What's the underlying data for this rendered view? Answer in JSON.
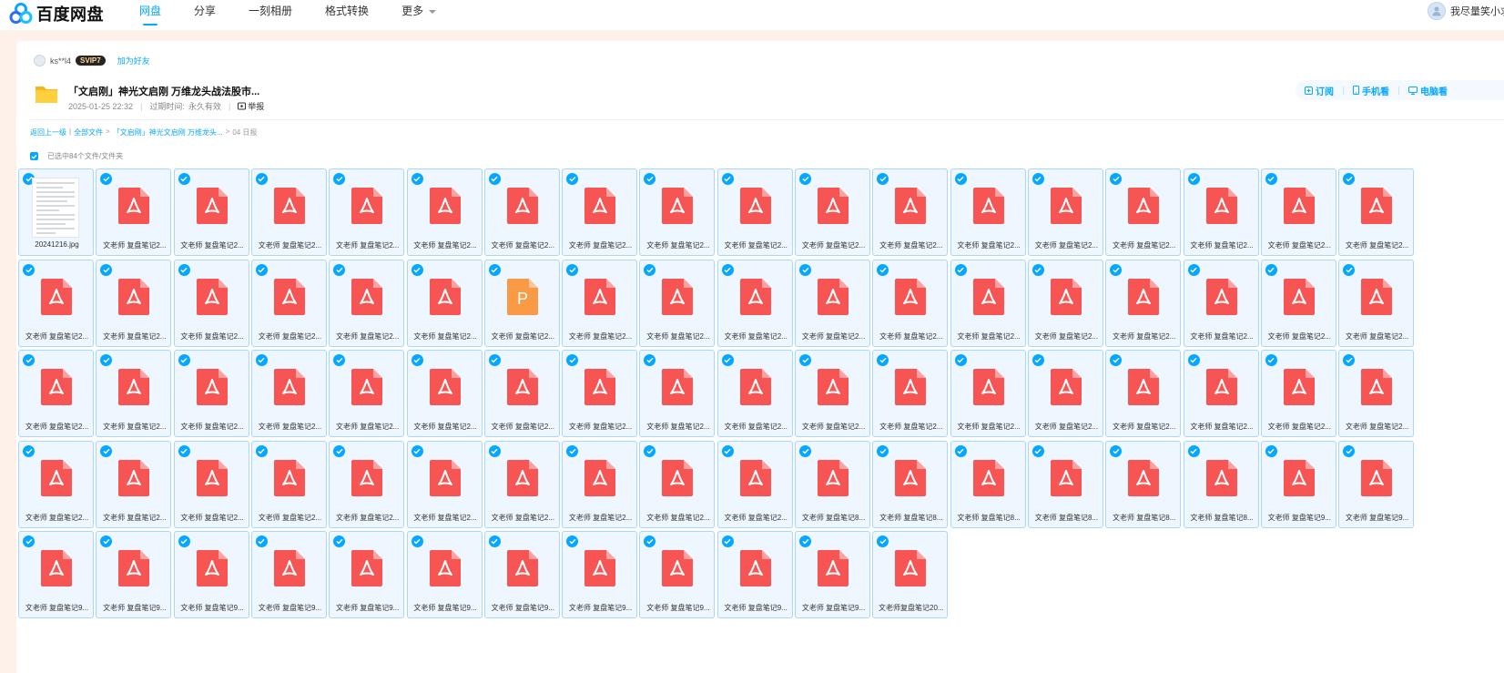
{
  "topbar": {
    "logo_text": "百度网盘",
    "nav": [
      "网盘",
      "分享",
      "一刻相册",
      "格式转换",
      "更多"
    ],
    "user_name": "我尽量笑小求"
  },
  "share": {
    "sharer_name": "ks**l4",
    "vip_badge": "SVIP7",
    "add_friend": "加为好友",
    "title": "「文启刚」神光文启刚 万维龙头战法股市...",
    "date": "2025-01-25 22:32",
    "expiry_label": "过期时间:",
    "expiry_value": "永久有效",
    "report": "举报",
    "actions": [
      "订阅",
      "手机看",
      "电脑看"
    ]
  },
  "breadcrumb": {
    "back": "返回上一级",
    "all_files": "全部文件",
    "folder": "「文启刚」神光文启刚 万维龙头...",
    "current": "04 日报"
  },
  "selection": {
    "text": "已选中84个文件/文件夹"
  },
  "colors": {
    "accent": "#06a7ff",
    "pdf_red": "#f75454",
    "ppt_orange": "#fa9a44",
    "tile_border": "#a8d6ff"
  },
  "files": [
    {
      "name": "20241216.jpg",
      "type": "jpg"
    },
    {
      "name": "文老师 复盘笔记2...",
      "type": "pdf"
    },
    {
      "name": "文老师 复盘笔记2...",
      "type": "pdf"
    },
    {
      "name": "文老师 复盘笔记2...",
      "type": "pdf"
    },
    {
      "name": "文老师 复盘笔记2...",
      "type": "pdf"
    },
    {
      "name": "文老师 复盘笔记2...",
      "type": "pdf"
    },
    {
      "name": "文老师 复盘笔记2...",
      "type": "pdf"
    },
    {
      "name": "文老师 复盘笔记2...",
      "type": "pdf"
    },
    {
      "name": "文老师 复盘笔记2...",
      "type": "pdf"
    },
    {
      "name": "文老师 复盘笔记2...",
      "type": "pdf"
    },
    {
      "name": "文老师 复盘笔记2...",
      "type": "pdf"
    },
    {
      "name": "文老师 复盘笔记2...",
      "type": "pdf"
    },
    {
      "name": "文老师 复盘笔记2...",
      "type": "pdf"
    },
    {
      "name": "文老师 复盘笔记2...",
      "type": "pdf"
    },
    {
      "name": "文老师 复盘笔记2...",
      "type": "pdf"
    },
    {
      "name": "文老师 复盘笔记2...",
      "type": "pdf"
    },
    {
      "name": "文老师 复盘笔记2...",
      "type": "pdf"
    },
    {
      "name": "文老师 复盘笔记2...",
      "type": "pdf"
    },
    {
      "name": "文老师 复盘笔记2...",
      "type": "pdf"
    },
    {
      "name": "文老师 复盘笔记2...",
      "type": "pdf"
    },
    {
      "name": "文老师 复盘笔记2...",
      "type": "pdf"
    },
    {
      "name": "文老师 复盘笔记2...",
      "type": "pdf"
    },
    {
      "name": "文老师 复盘笔记2...",
      "type": "pdf"
    },
    {
      "name": "文老师 复盘笔记2...",
      "type": "pdf"
    },
    {
      "name": "文老师 复盘笔记2...",
      "type": "ppt",
      "glyph": "P"
    },
    {
      "name": "文老师 复盘笔记2...",
      "type": "pdf"
    },
    {
      "name": "文老师 复盘笔记2...",
      "type": "pdf"
    },
    {
      "name": "文老师 复盘笔记2...",
      "type": "pdf"
    },
    {
      "name": "文老师 复盘笔记2...",
      "type": "pdf"
    },
    {
      "name": "文老师 复盘笔记2...",
      "type": "pdf"
    },
    {
      "name": "文老师 复盘笔记2...",
      "type": "pdf"
    },
    {
      "name": "文老师 复盘笔记2...",
      "type": "pdf"
    },
    {
      "name": "文老师 复盘笔记2...",
      "type": "pdf"
    },
    {
      "name": "文老师 复盘笔记2...",
      "type": "pdf"
    },
    {
      "name": "文老师 复盘笔记2...",
      "type": "pdf"
    },
    {
      "name": "文老师 复盘笔记2...",
      "type": "pdf"
    },
    {
      "name": "文老师 复盘笔记2...",
      "type": "pdf"
    },
    {
      "name": "文老师 复盘笔记2...",
      "type": "pdf"
    },
    {
      "name": "文老师 复盘笔记2...",
      "type": "pdf"
    },
    {
      "name": "文老师 复盘笔记2...",
      "type": "pdf"
    },
    {
      "name": "文老师 复盘笔记2...",
      "type": "pdf"
    },
    {
      "name": "文老师 复盘笔记2...",
      "type": "pdf"
    },
    {
      "name": "文老师 复盘笔记2...",
      "type": "pdf"
    },
    {
      "name": "文老师 复盘笔记2...",
      "type": "pdf"
    },
    {
      "name": "文老师 复盘笔记2...",
      "type": "pdf"
    },
    {
      "name": "文老师 复盘笔记2...",
      "type": "pdf"
    },
    {
      "name": "文老师 复盘笔记2...",
      "type": "pdf"
    },
    {
      "name": "文老师 复盘笔记2...",
      "type": "pdf"
    },
    {
      "name": "文老师 复盘笔记2...",
      "type": "pdf"
    },
    {
      "name": "文老师 复盘笔记2...",
      "type": "pdf"
    },
    {
      "name": "文老师 复盘笔记2...",
      "type": "pdf"
    },
    {
      "name": "文老师 复盘笔记2...",
      "type": "pdf"
    },
    {
      "name": "文老师 复盘笔记2...",
      "type": "pdf"
    },
    {
      "name": "文老师 复盘笔记2...",
      "type": "pdf"
    },
    {
      "name": "文老师 复盘笔记2...",
      "type": "pdf"
    },
    {
      "name": "文老师 复盘笔记2...",
      "type": "pdf"
    },
    {
      "name": "文老师 复盘笔记2...",
      "type": "pdf"
    },
    {
      "name": "文老师 复盘笔记2...",
      "type": "pdf"
    },
    {
      "name": "文老师 复盘笔记2...",
      "type": "pdf"
    },
    {
      "name": "文老师 复盘笔记2...",
      "type": "pdf"
    },
    {
      "name": "文老师 复盘笔记2...",
      "type": "pdf"
    },
    {
      "name": "文老师 复盘笔记2...",
      "type": "pdf"
    },
    {
      "name": "文老师 复盘笔记2...",
      "type": "pdf"
    },
    {
      "name": "文老师 复盘笔记2...",
      "type": "pdf"
    },
    {
      "name": "文老师 复盘笔记8...",
      "type": "pdf"
    },
    {
      "name": "文老师 复盘笔记8...",
      "type": "pdf"
    },
    {
      "name": "文老师 复盘笔记8...",
      "type": "pdf"
    },
    {
      "name": "文老师 复盘笔记8...",
      "type": "pdf"
    },
    {
      "name": "文老师 复盘笔记8...",
      "type": "pdf"
    },
    {
      "name": "文老师 复盘笔记8...",
      "type": "pdf"
    },
    {
      "name": "文老师 复盘笔记9...",
      "type": "pdf"
    },
    {
      "name": "文老师 复盘笔记9...",
      "type": "pdf"
    },
    {
      "name": "文老师 复盘笔记9...",
      "type": "pdf"
    },
    {
      "name": "文老师 复盘笔记9...",
      "type": "pdf"
    },
    {
      "name": "文老师 复盘笔记9...",
      "type": "pdf"
    },
    {
      "name": "文老师 复盘笔记9...",
      "type": "pdf"
    },
    {
      "name": "文老师 复盘笔记9...",
      "type": "pdf"
    },
    {
      "name": "文老师 复盘笔记9...",
      "type": "pdf"
    },
    {
      "name": "文老师 复盘笔记9...",
      "type": "pdf"
    },
    {
      "name": "文老师 复盘笔记9...",
      "type": "pdf"
    },
    {
      "name": "文老师 复盘笔记9...",
      "type": "pdf"
    },
    {
      "name": "文老师 复盘笔记9...",
      "type": "pdf"
    },
    {
      "name": "文老师 复盘笔记9...",
      "type": "pdf"
    },
    {
      "name": "文老师复盘笔记20...",
      "type": "pdf"
    }
  ]
}
